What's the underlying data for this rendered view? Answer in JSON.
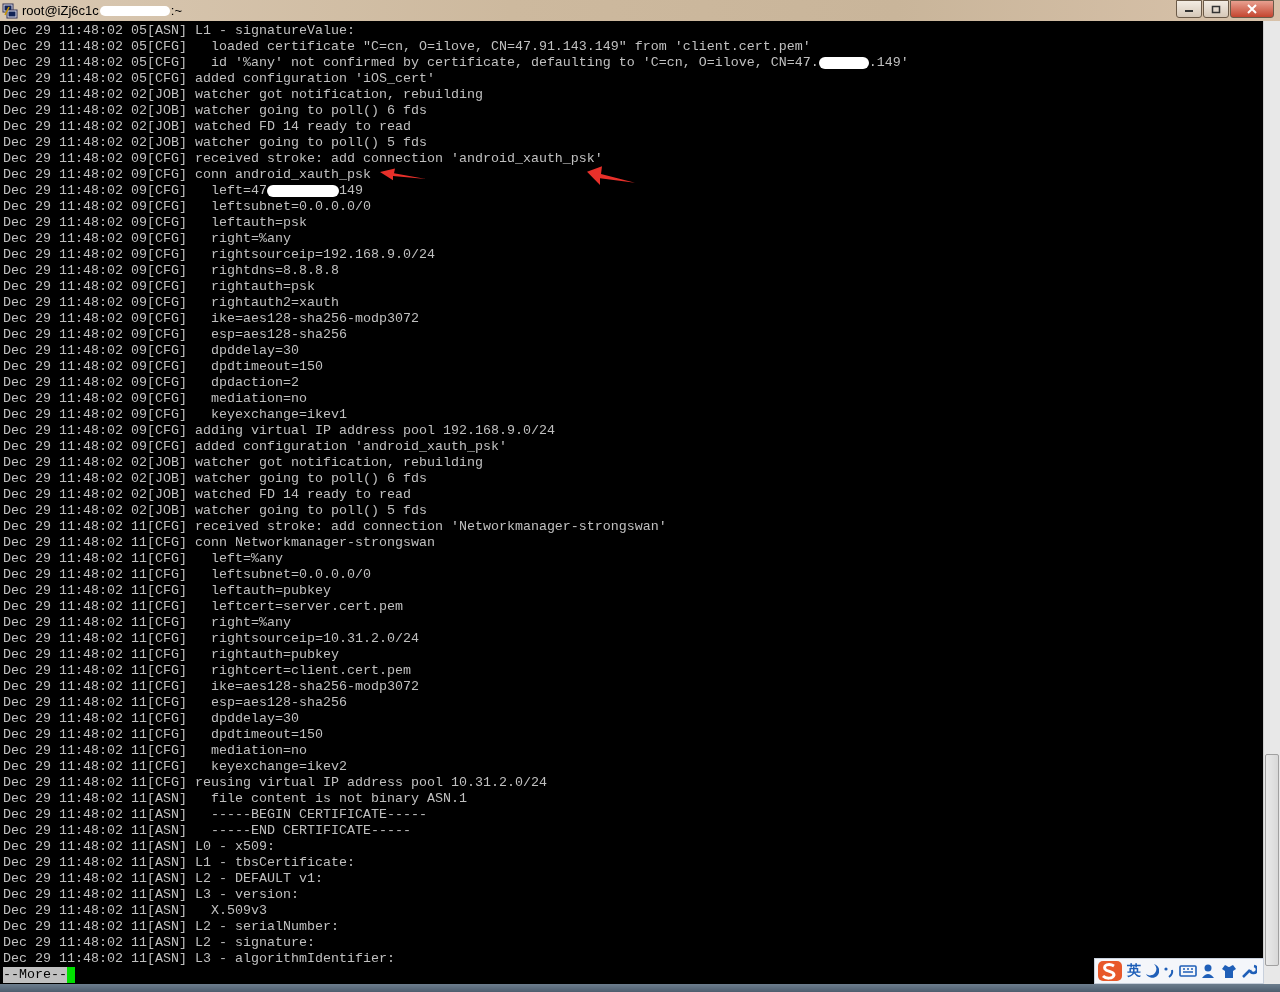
{
  "window": {
    "title": {
      "text": "root@iZj6c1c",
      "after_redaction": ":~"
    }
  },
  "terminal": {
    "lines": [
      {
        "text": "Dec 29 11:48:02 05[ASN] L1 - signatureValue:"
      },
      {
        "text": "Dec 29 11:48:02 05[CFG]   loaded certificate \"C=cn, O=ilove, CN=47.91.143.149\" from 'client.cert.pem'"
      },
      {
        "text": "Dec 29 11:48:02 05[CFG]   id '%any' not confirmed by certificate, defaulting to 'C=cn, O=ilove, CN=47.",
        "after_redaction": ".149'"
      },
      {
        "text": "Dec 29 11:48:02 05[CFG] added configuration 'iOS_cert'"
      },
      {
        "text": "Dec 29 11:48:02 02[JOB] watcher got notification, rebuilding"
      },
      {
        "text": "Dec 29 11:48:02 02[JOB] watcher going to poll() 6 fds"
      },
      {
        "text": "Dec 29 11:48:02 02[JOB] watched FD 14 ready to read"
      },
      {
        "text": "Dec 29 11:48:02 02[JOB] watcher going to poll() 5 fds"
      },
      {
        "text": "Dec 29 11:48:02 09[CFG] received stroke: add connection 'android_xauth_psk'"
      },
      {
        "text": "Dec 29 11:48:02 09[CFG] conn android_xauth_psk"
      },
      {
        "text": "Dec 29 11:48:02 09[CFG]   left=47",
        "after_redaction": "149"
      },
      {
        "text": "Dec 29 11:48:02 09[CFG]   leftsubnet=0.0.0.0/0"
      },
      {
        "text": "Dec 29 11:48:02 09[CFG]   leftauth=psk"
      },
      {
        "text": "Dec 29 11:48:02 09[CFG]   right=%any"
      },
      {
        "text": "Dec 29 11:48:02 09[CFG]   rightsourceip=192.168.9.0/24"
      },
      {
        "text": "Dec 29 11:48:02 09[CFG]   rightdns=8.8.8.8"
      },
      {
        "text": "Dec 29 11:48:02 09[CFG]   rightauth=psk"
      },
      {
        "text": "Dec 29 11:48:02 09[CFG]   rightauth2=xauth"
      },
      {
        "text": "Dec 29 11:48:02 09[CFG]   ike=aes128-sha256-modp3072"
      },
      {
        "text": "Dec 29 11:48:02 09[CFG]   esp=aes128-sha256"
      },
      {
        "text": "Dec 29 11:48:02 09[CFG]   dpddelay=30"
      },
      {
        "text": "Dec 29 11:48:02 09[CFG]   dpdtimeout=150"
      },
      {
        "text": "Dec 29 11:48:02 09[CFG]   dpdaction=2"
      },
      {
        "text": "Dec 29 11:48:02 09[CFG]   mediation=no"
      },
      {
        "text": "Dec 29 11:48:02 09[CFG]   keyexchange=ikev1"
      },
      {
        "text": "Dec 29 11:48:02 09[CFG] adding virtual IP address pool 192.168.9.0/24"
      },
      {
        "text": "Dec 29 11:48:02 09[CFG] added configuration 'android_xauth_psk'"
      },
      {
        "text": "Dec 29 11:48:02 02[JOB] watcher got notification, rebuilding"
      },
      {
        "text": "Dec 29 11:48:02 02[JOB] watcher going to poll() 6 fds"
      },
      {
        "text": "Dec 29 11:48:02 02[JOB] watched FD 14 ready to read"
      },
      {
        "text": "Dec 29 11:48:02 02[JOB] watcher going to poll() 5 fds"
      },
      {
        "text": "Dec 29 11:48:02 11[CFG] received stroke: add connection 'Networkmanager-strongswan'"
      },
      {
        "text": "Dec 29 11:48:02 11[CFG] conn Networkmanager-strongswan"
      },
      {
        "text": "Dec 29 11:48:02 11[CFG]   left=%any"
      },
      {
        "text": "Dec 29 11:48:02 11[CFG]   leftsubnet=0.0.0.0/0"
      },
      {
        "text": "Dec 29 11:48:02 11[CFG]   leftauth=pubkey"
      },
      {
        "text": "Dec 29 11:48:02 11[CFG]   leftcert=server.cert.pem"
      },
      {
        "text": "Dec 29 11:48:02 11[CFG]   right=%any"
      },
      {
        "text": "Dec 29 11:48:02 11[CFG]   rightsourceip=10.31.2.0/24"
      },
      {
        "text": "Dec 29 11:48:02 11[CFG]   rightauth=pubkey"
      },
      {
        "text": "Dec 29 11:48:02 11[CFG]   rightcert=client.cert.pem"
      },
      {
        "text": "Dec 29 11:48:02 11[CFG]   ike=aes128-sha256-modp3072"
      },
      {
        "text": "Dec 29 11:48:02 11[CFG]   esp=aes128-sha256"
      },
      {
        "text": "Dec 29 11:48:02 11[CFG]   dpddelay=30"
      },
      {
        "text": "Dec 29 11:48:02 11[CFG]   dpdtimeout=150"
      },
      {
        "text": "Dec 29 11:48:02 11[CFG]   mediation=no"
      },
      {
        "text": "Dec 29 11:48:02 11[CFG]   keyexchange=ikev2"
      },
      {
        "text": "Dec 29 11:48:02 11[CFG] reusing virtual IP address pool 10.31.2.0/24"
      },
      {
        "text": "Dec 29 11:48:02 11[ASN]   file content is not binary ASN.1"
      },
      {
        "text": "Dec 29 11:48:02 11[ASN]   -----BEGIN CERTIFICATE-----"
      },
      {
        "text": "Dec 29 11:48:02 11[ASN]   -----END CERTIFICATE-----"
      },
      {
        "text": "Dec 29 11:48:02 11[ASN] L0 - x509:"
      },
      {
        "text": "Dec 29 11:48:02 11[ASN] L1 - tbsCertificate:"
      },
      {
        "text": "Dec 29 11:48:02 11[ASN] L2 - DEFAULT v1:"
      },
      {
        "text": "Dec 29 11:48:02 11[ASN] L3 - version:"
      },
      {
        "text": "Dec 29 11:48:02 11[ASN]   X.509v3"
      },
      {
        "text": "Dec 29 11:48:02 11[ASN] L2 - serialNumber:"
      },
      {
        "text": "Dec 29 11:48:02 11[ASN] L2 - signature:"
      },
      {
        "text": "Dec 29 11:48:02 11[ASN] L3 - algorithmIdentifier:"
      }
    ],
    "pager_prompt": "--More--"
  },
  "ime_bar": {
    "mode_label": "英"
  }
}
